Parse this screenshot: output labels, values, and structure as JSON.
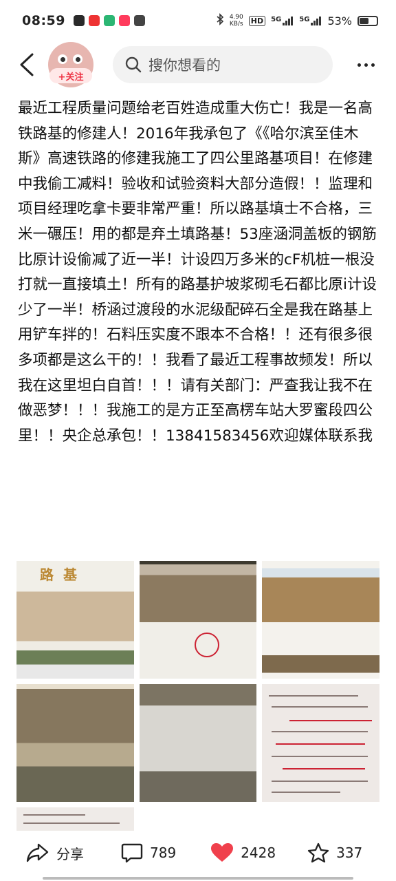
{
  "status_bar": {
    "time": "08:59",
    "net_speed_value": "4.90",
    "net_speed_unit": "KB/s",
    "signal_1": "5G",
    "signal_2": "5G",
    "hd_badge": "HD",
    "battery_percent": "53%",
    "battery_level": 0.53,
    "icons": [
      "bluetooth-icon",
      "hd-icon",
      "signal-icon",
      "signal-icon",
      "battery-icon"
    ]
  },
  "header": {
    "follow_label": "+关注",
    "search_placeholder": "搜你想看的",
    "icons": [
      "back-arrow-icon",
      "search-icon",
      "more-icon"
    ]
  },
  "post": {
    "text": "最近工程质量问题给老百姓造成重大伤亡！我是一名高铁路基的修建人！2016年我承包了《《哈尔滨至佳木斯》高速铁路的修建我施工了四公里路基项目！在修建中我偷工减料！验收和试验资料大部分造假！！监理和项目经理吃拿卡要非常严重！所以路基填士不合格，三米一碾压！用的都是弃土填路基！53座涵洞盖板的钢筋比原计设偷减了近一半！计设四万多米的cF机桩一根没打就一直接填土！所有的路基护坡浆砌毛石都比原i计设少了一半！桥涵过渡段的水泥级配碎石全是我在路基上用铲车拌的！石料压实度不跟本不合格！！还有很多很多项都是这么干的！！我看了最近工程事故频发！所以我在这里坦白自首！！！请有关部门：严查我让我不在做恶梦！！！我施工的是方正至高楞车站大罗蜜段四公里！！央企总承包！！13841583456欢迎媒体联系我"
  },
  "images": {
    "photo1_label": "路基"
  },
  "actions": {
    "share_label": "分享",
    "comment_count": "789",
    "like_count": "2428",
    "favorite_count": "337",
    "like_color": "#f0404c"
  }
}
